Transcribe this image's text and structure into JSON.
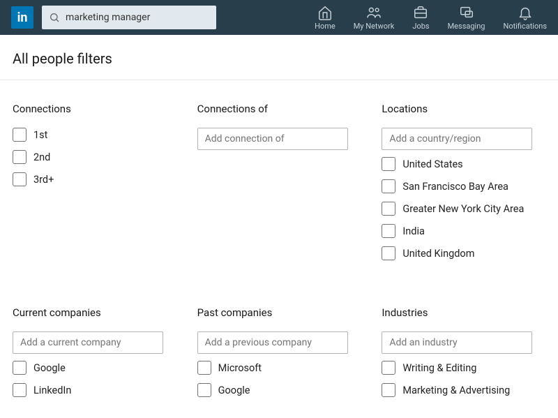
{
  "logo_text": "in",
  "search": {
    "value": "marketing manager"
  },
  "nav": [
    {
      "key": "home",
      "label": "Home"
    },
    {
      "key": "network",
      "label": "My Network"
    },
    {
      "key": "jobs",
      "label": "Jobs"
    },
    {
      "key": "messaging",
      "label": "Messaging"
    },
    {
      "key": "notifications",
      "label": "Notifications"
    }
  ],
  "page_title": "All people filters",
  "filters": {
    "connections": {
      "heading": "Connections",
      "options": [
        "1st",
        "2nd",
        "3rd+"
      ]
    },
    "connections_of": {
      "heading": "Connections of",
      "placeholder": "Add connection of"
    },
    "locations": {
      "heading": "Locations",
      "placeholder": "Add a country/region",
      "options": [
        "United States",
        "San Francisco Bay Area",
        "Greater New York City Area",
        "India",
        "United Kingdom"
      ]
    },
    "current_companies": {
      "heading": "Current companies",
      "placeholder": "Add a current company",
      "options": [
        "Google",
        "LinkedIn"
      ]
    },
    "past_companies": {
      "heading": "Past companies",
      "placeholder": "Add a previous company",
      "options": [
        "Microsoft",
        "Google"
      ]
    },
    "industries": {
      "heading": "Industries",
      "placeholder": "Add an industry",
      "options": [
        "Writing & Editing",
        "Marketing & Advertising"
      ]
    }
  }
}
